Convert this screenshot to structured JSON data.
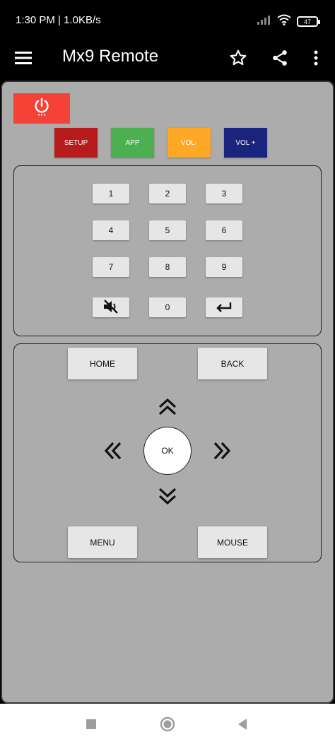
{
  "status_bar": {
    "time_speed": "1:30 PM | 1.0KB/s",
    "battery": "47"
  },
  "app_bar": {
    "title": "Mx9 Remote"
  },
  "top_buttons": {
    "setup": "SETUP",
    "app": "APP",
    "vol_down": "VOL-",
    "vol_up": "VOL +"
  },
  "colors": {
    "power": "#f44336",
    "setup": "#b71c1c",
    "app": "#4caf50",
    "vol_down": "#ffa726",
    "vol_up": "#1a237e"
  },
  "numpad": {
    "k1": "1",
    "k2": "2",
    "k3": "3",
    "k4": "4",
    "k5": "5",
    "k6": "6",
    "k7": "7",
    "k8": "8",
    "k9": "9",
    "k0": "0"
  },
  "navpad": {
    "home": "HOME",
    "back": "BACK",
    "ok": "OK",
    "menu": "MENU",
    "mouse": "MOUSE"
  },
  "icons": {
    "menu": "hamburger-icon",
    "favorite": "star-icon",
    "share": "share-icon",
    "more": "more-vert-icon",
    "power": "power-icon",
    "mute": "mute-icon",
    "enter": "enter-icon"
  }
}
